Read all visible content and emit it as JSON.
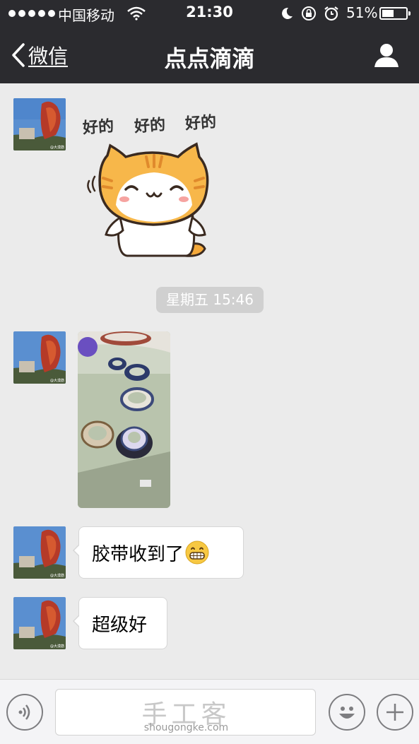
{
  "status_bar": {
    "carrier": "中国移动",
    "time": "21:30",
    "battery_percent": "51%",
    "battery_level": 0.51
  },
  "nav": {
    "back_label": "微信",
    "title": "点点滴滴"
  },
  "messages": {
    "sticker_text": [
      "好的",
      "好的",
      "好的"
    ],
    "timestamp": "星期五 15:46",
    "bubble1": "胶带收到了",
    "bubble2": "超级好"
  },
  "avatar_caption": "@大漠筋",
  "input_bar": {
    "watermark_cn": "手工客",
    "watermark_en": "shougongke.com"
  },
  "colors": {
    "nav_bg": "#2b2b2f",
    "chat_bg": "#ebebeb",
    "bubble_bg": "#ffffff",
    "timestamp_bg": "#d0d0d0"
  }
}
